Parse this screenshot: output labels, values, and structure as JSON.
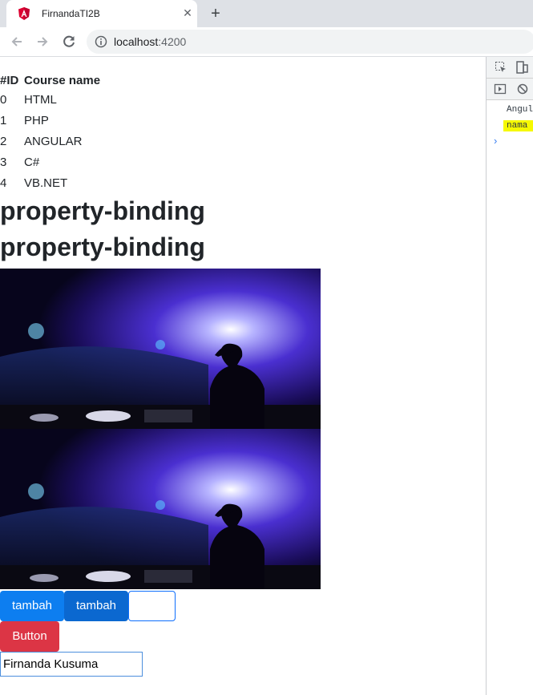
{
  "browser": {
    "tab_title": "FirnandaTI2B",
    "new_tab_symbol": "+",
    "close_symbol": "✕",
    "url_host": "localhost",
    "url_port": ":4200"
  },
  "table": {
    "headers": [
      "#ID",
      "Course name"
    ],
    "rows": [
      {
        "id": "0",
        "name": "HTML"
      },
      {
        "id": "1",
        "name": "PHP"
      },
      {
        "id": "2",
        "name": "ANGULAR"
      },
      {
        "id": "3",
        "name": "C#"
      },
      {
        "id": "4",
        "name": "VB.NET"
      }
    ]
  },
  "headings": [
    "property-binding",
    "property-binding"
  ],
  "buttons": {
    "tambah_1": "tambah",
    "tambah_2": "tambah",
    "empty_button": "",
    "danger_button": "Button"
  },
  "name_input": {
    "value": "Firnanda Kusuma"
  },
  "devtools": {
    "log_text": "Angul",
    "highlight_text": "nama",
    "prompt_symbol": "›"
  },
  "colors": {
    "primary": "#0d7ef0",
    "primary_dark": "#0b68d0",
    "danger": "#dc3545",
    "highlight": "#f6f900"
  },
  "icons": {
    "favicon": "angular-logo-icon",
    "back": "arrow-left-icon",
    "forward": "arrow-right-icon",
    "reload": "reload-icon",
    "site_info": "info-icon"
  }
}
